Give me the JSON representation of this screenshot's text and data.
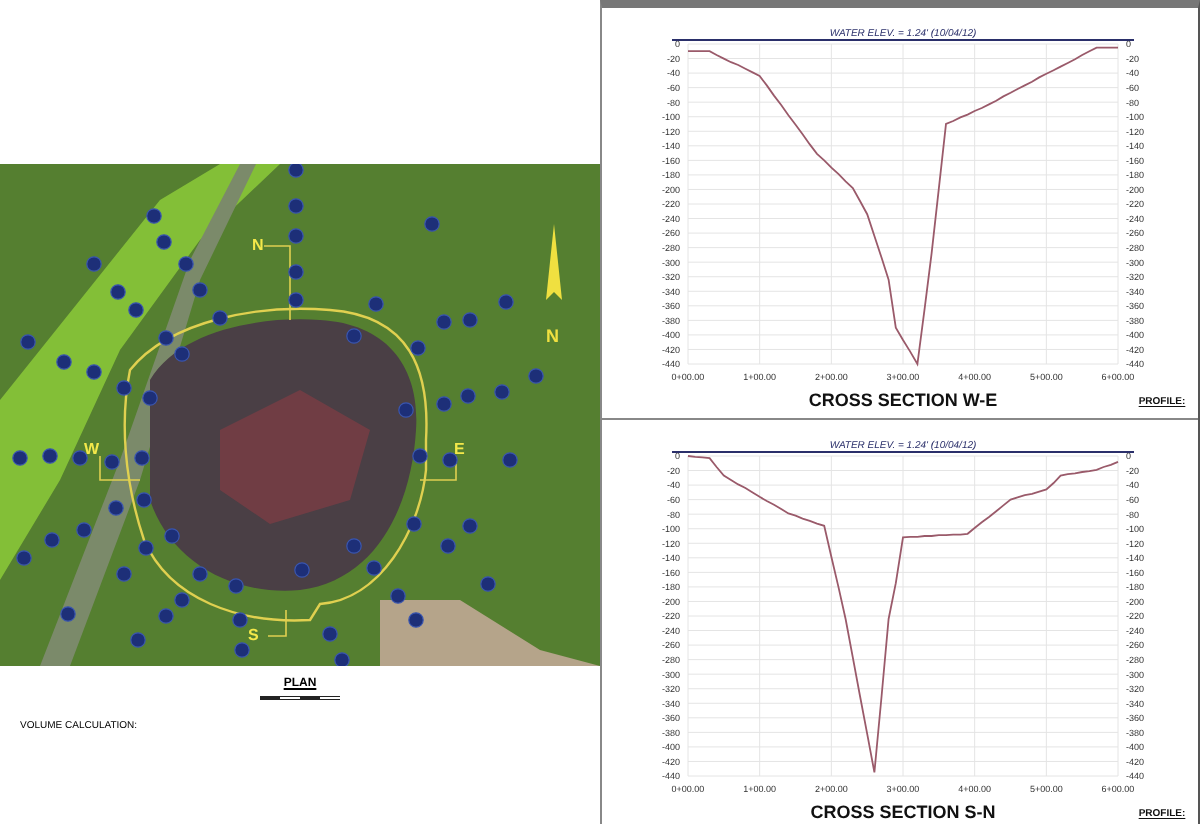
{
  "plan": {
    "map_labels": [
      {
        "text": "N",
        "kind": "section"
      },
      {
        "text": "W",
        "kind": "section"
      },
      {
        "text": "E",
        "kind": "section"
      },
      {
        "text": "S",
        "kind": "section"
      },
      {
        "text": "N",
        "kind": "north"
      }
    ],
    "title": "PLAN",
    "note": "VOLUME CALCULATION:"
  },
  "sections": [
    {
      "title": "CROSS SECTION W-E",
      "profile_label": "PROFILE:",
      "right_axis_ticks": [
        "0",
        "-20",
        "-40",
        "-60",
        "-80",
        "-100",
        "-120",
        "-140",
        "-160",
        "-180",
        "-200",
        "-220",
        "-240",
        "-260",
        "-280",
        "-300",
        "-320",
        "-340",
        "-360",
        "-380",
        "-400",
        "-420",
        "-440"
      ],
      "chart_data": {
        "type": "line",
        "grid": true,
        "categories": [
          "0+00.00",
          null,
          null,
          null,
          null,
          null,
          null,
          null,
          null,
          null,
          "1+00.00",
          null,
          null,
          null,
          null,
          null,
          null,
          null,
          null,
          null,
          "2+00.00",
          null,
          null,
          null,
          null,
          null,
          null,
          null,
          null,
          null,
          "3+00.00",
          null,
          null,
          null,
          null,
          null,
          null,
          null,
          null,
          null,
          "4+00.00",
          null,
          null,
          null,
          null,
          null,
          null,
          null,
          null,
          null,
          "5+00.00",
          null,
          null,
          null,
          null,
          null,
          null,
          null,
          null,
          null,
          "6+00.00"
        ],
        "series": [
          {
            "color": "#9a5a6a",
            "values": [
              -10,
              -10,
              -10,
              -10,
              -15,
              -20,
              -25,
              -29,
              -34,
              -39,
              -44,
              -57,
              -71,
              -84,
              -98,
              -111,
              -124,
              -138,
              -151,
              -160,
              -170,
              -179,
              -189,
              -198,
              -216,
              -234,
              -264,
              -294,
              -324,
              -390,
              -407,
              -423,
              -440,
              -364,
              -288,
              -199,
              -110,
              -106,
              -101,
              -97,
              -92,
              -88,
              -83,
              -78,
              -72,
              -67,
              -62,
              -57,
              -52,
              -46,
              -41,
              -36,
              -31,
              -26,
              -21,
              -15,
              -10,
              -5,
              -5,
              -5,
              -5
            ]
          }
        ],
        "ylim": [
          -440,
          0
        ],
        "yticks": [
          0,
          -20,
          -40,
          -60,
          -80,
          -100,
          -120,
          -140,
          -160,
          -180,
          -200,
          -220,
          -240,
          -260,
          -280,
          -300,
          -320,
          -340,
          -360,
          -380,
          -400,
          -420,
          -440
        ],
        "annotations": [
          "WATER ELEV. = 1.24' (10/04/12)"
        ]
      }
    },
    {
      "title": "CROSS SECTION S-N",
      "profile_label": "PROFILE:",
      "right_axis_ticks": [
        "0",
        "-20",
        "-40",
        "-60",
        "-80",
        "-100",
        "-120",
        "-140",
        "-160",
        "-180",
        "-200",
        "-220",
        "-240",
        "-260",
        "-280",
        "-300",
        "-320",
        "-340",
        "-360",
        "-380",
        "-400",
        "-420",
        "-440"
      ],
      "chart_data": {
        "type": "line",
        "grid": true,
        "categories": [
          "0+00.00",
          null,
          null,
          null,
          null,
          null,
          null,
          null,
          null,
          null,
          "1+00.00",
          null,
          null,
          null,
          null,
          null,
          null,
          null,
          null,
          null,
          "2+00.00",
          null,
          null,
          null,
          null,
          null,
          null,
          null,
          null,
          null,
          "3+00.00",
          null,
          null,
          null,
          null,
          null,
          null,
          null,
          null,
          null,
          "4+00.00",
          null,
          null,
          null,
          null,
          null,
          null,
          null,
          null,
          null,
          "5+00.00",
          null,
          null,
          null,
          null,
          null,
          null,
          null,
          null,
          null,
          "6+00.00"
        ],
        "series": [
          {
            "color": "#9a5a6a",
            "values": [
              0,
              -1,
              -2,
              -3,
              -15,
              -27,
              -33,
              -39,
              -44,
              -50,
              -56,
              -62,
              -67,
              -73,
              -79,
              -82,
              -86,
              -89,
              -93,
              -96,
              -139,
              -181,
              -224,
              -277,
              -330,
              -382,
              -435,
              -330,
              -224,
              -175,
              -112,
              -111,
              -111,
              -110,
              -110,
              -109,
              -109,
              -108,
              -108,
              -107,
              -99,
              -91,
              -84,
              -76,
              -68,
              -60,
              -57,
              -54,
              -52,
              -49,
              -46,
              -37,
              -27,
              -25,
              -24,
              -22,
              -21,
              -19,
              -15,
              -12,
              -8
            ]
          }
        ],
        "ylim": [
          -440,
          0
        ],
        "yticks": [
          0,
          -20,
          -40,
          -60,
          -80,
          -100,
          -120,
          -140,
          -160,
          -180,
          -200,
          -220,
          -240,
          -260,
          -280,
          -300,
          -320,
          -340,
          -360,
          -380,
          -400,
          -420,
          -440
        ],
        "annotations": [
          "WATER ELEV. = 1.24' (10/04/12)"
        ]
      }
    }
  ]
}
